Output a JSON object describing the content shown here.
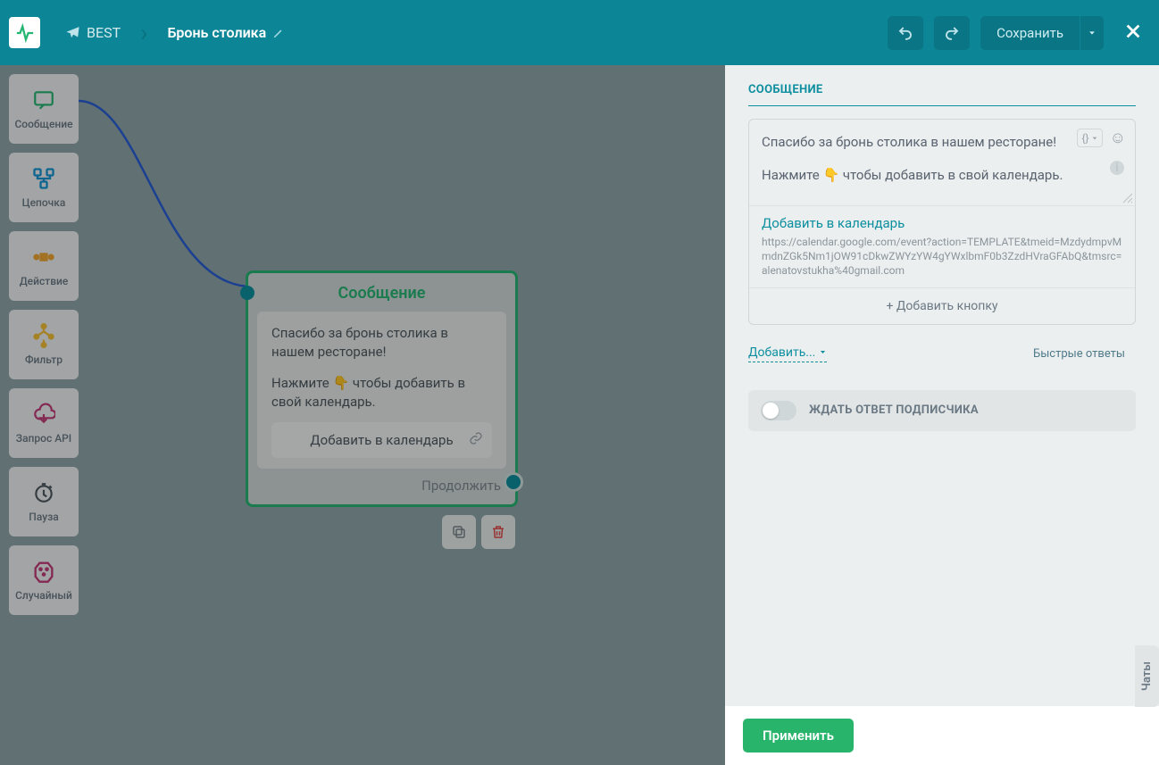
{
  "header": {
    "botName": "BEST",
    "flowName": "Бронь столика",
    "saveLabel": "Сохранить"
  },
  "palette": [
    {
      "key": "message",
      "label": "Сообщение",
      "color": "#26b673"
    },
    {
      "key": "chain",
      "label": "Цепочка",
      "color": "#1597d4"
    },
    {
      "key": "action",
      "label": "Действие",
      "color": "#f0a733"
    },
    {
      "key": "filter",
      "label": "Фильтр",
      "color": "#f2c037"
    },
    {
      "key": "api",
      "label": "Запрос API",
      "color": "#c23d7a"
    },
    {
      "key": "pause",
      "label": "Пауза",
      "color": "#4f5a62"
    },
    {
      "key": "random",
      "label": "Случайный",
      "color": "#c23d7a"
    }
  ],
  "node": {
    "title": "Сообщение",
    "line1": "Спасибо за бронь столика в нашем ресторане!",
    "line2a": "Нажмите ",
    "line2emoji": "👇",
    "line2b": " чтобы добавить в свой календарь.",
    "buttonLabel": "Добавить в календарь",
    "continueLabel": "Продолжить"
  },
  "panel": {
    "title": "СООБЩЕНИЕ",
    "msgLine1": "Спасибо за бронь столика в нашем ресторане!",
    "msgLine2a": "Нажмите ",
    "msgLine2emoji": "👇",
    "msgLine2b": " чтобы добавить в свой календарь.",
    "varBtn": "{}",
    "button": {
      "label": "Добавить в календарь",
      "url": "https://calendar.google.com/event?action=TEMPLATE&tmeid=MzdydmpvMmdnZGk5Nm1jOW91cDkwZWYzYW4gYWxlbmF0b3ZzdHVraGFAbQ&tmsrc=alenatovstukha%40gmail.com"
    },
    "addButtonLabel": "+ Добавить кнопку",
    "addMenuLabel": "Добавить...",
    "quickRepliesLabel": "Быстрые ответы",
    "waitLabel": "ЖДАТЬ ОТВЕТ ПОДПИСЧИКА",
    "applyLabel": "Применить"
  },
  "chatsTab": "Чаты"
}
